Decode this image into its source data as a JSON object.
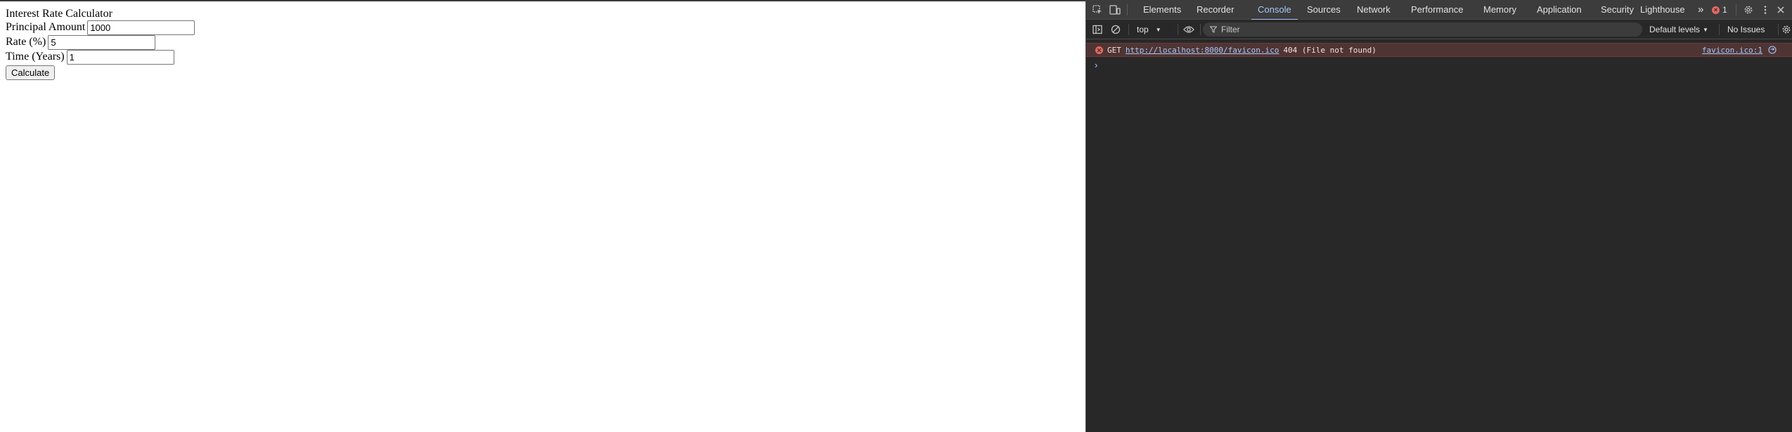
{
  "page": {
    "title": "Interest Rate Calculator",
    "principal_label": "Principal Amount",
    "principal_value": "1000",
    "rate_label": "Rate (%)",
    "rate_value": "5",
    "time_label": "Time (Years)",
    "time_value": "1",
    "calculate_label": "Calculate"
  },
  "devtools": {
    "tabs": [
      {
        "label": "Elements"
      },
      {
        "label": "Recorder"
      },
      {
        "label": "Console",
        "active": true
      },
      {
        "label": "Sources"
      },
      {
        "label": "Network"
      },
      {
        "label": "Performance"
      },
      {
        "label": "Memory"
      },
      {
        "label": "Application"
      },
      {
        "label": "Security"
      },
      {
        "label": "Lighthouse"
      }
    ],
    "more_tabs": "»",
    "error_count": "1",
    "toolbar": {
      "context": "top",
      "filter_placeholder": "Filter",
      "levels": "Default levels",
      "issues": "No Issues"
    },
    "messages": [
      {
        "method": "GET",
        "url": "http://localhost:8000/favicon.ico",
        "status": "404 (File not found)",
        "source": "favicon.ico:1"
      }
    ],
    "prompt": "›",
    "colors": {
      "panel_bg": "#282828",
      "tabbar_bg": "#3c3c3c",
      "accent": "#a8c7fa",
      "error_bg": "#4e3534",
      "error_icon": "#e46962"
    }
  }
}
